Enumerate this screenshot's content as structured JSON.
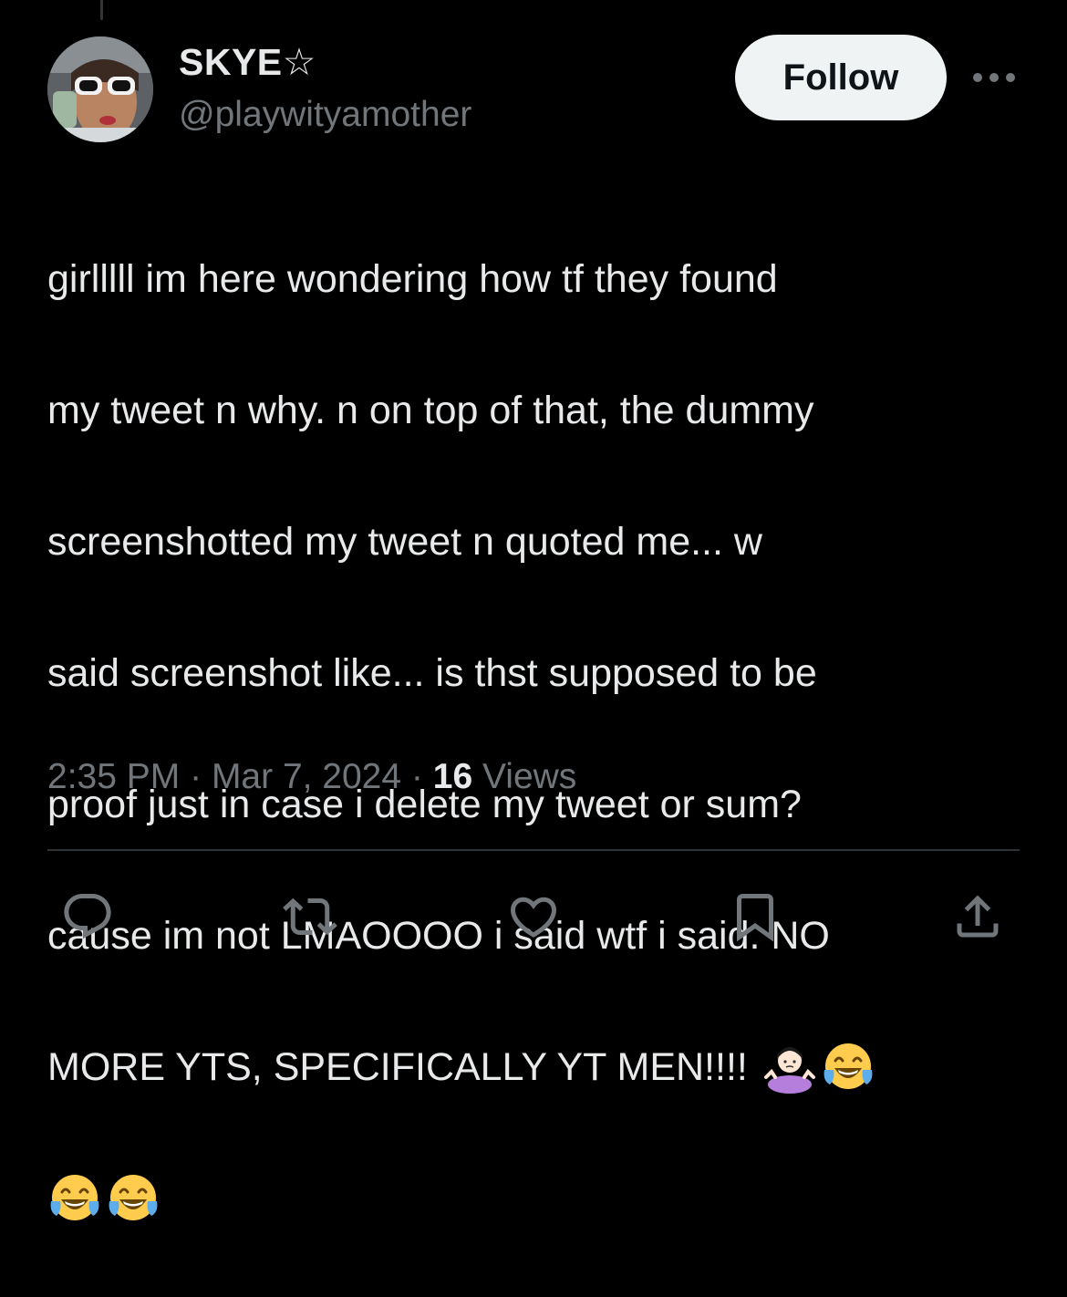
{
  "author": {
    "display_name": "SKYE☆",
    "handle": "@playwityamother",
    "avatar_icon": "profile-photo"
  },
  "follow_button": {
    "label": "Follow"
  },
  "more_menu": {
    "icon": "more-horizontal-icon"
  },
  "tweet": {
    "lines": [
      "girlllll im here wondering how tf they found",
      "my tweet n why. n on top of that, the dummy",
      "screenshotted my tweet n quoted me... w",
      "said screenshot like... is thst supposed to be",
      "proof just in case i delete my tweet or sum?",
      "cause im not LMAOOOO i said wtf i said. NO",
      "MORE YTS, SPECIFICALLY YT MEN!!!!"
    ],
    "emojis_line7": [
      "shrug-emoji",
      "laughing-crying-emoji"
    ],
    "emojis_line8": [
      "laughing-crying-emoji",
      "laughing-crying-emoji"
    ]
  },
  "meta": {
    "time": "2:35 PM",
    "separator": "·",
    "date": "Mar 7, 2024",
    "views_count": "16",
    "views_label": "Views"
  },
  "actions": [
    {
      "icon": "reply-icon"
    },
    {
      "icon": "retweet-icon"
    },
    {
      "icon": "like-icon"
    },
    {
      "icon": "bookmark-icon"
    },
    {
      "icon": "share-icon"
    }
  ],
  "colors": {
    "background": "#000000",
    "primary_text": "#e7e9ea",
    "secondary_text": "#71767b",
    "divider": "#2f3336",
    "follow_bg": "#eff3f4"
  }
}
